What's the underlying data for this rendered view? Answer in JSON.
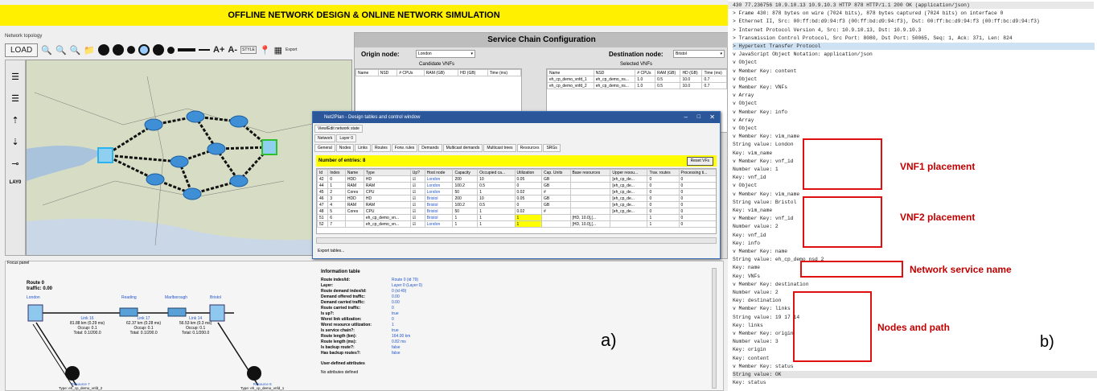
{
  "title": "OFFLINE NETWORK DESIGN & ONLINE NETWORK SIMULATION",
  "topology_label": "Network topology",
  "toolbar": {
    "load": "LOAD",
    "textplus": "A+",
    "textminus": "A-",
    "style": "STYLE",
    "export": "Export"
  },
  "sidebar_layer": "LAY0",
  "service_chain": {
    "header": "Service Chain Configuration",
    "origin_label": "Origin node:",
    "origin_value": "London",
    "destination_label": "Destination node:",
    "destination_value": "Bristol",
    "candidate_title": "Candidate VNFs",
    "selected_title": "Selected VNFs",
    "candidate_cols": [
      "Name",
      "NSD",
      "# CPUs",
      "RAM (GB)",
      "HD (GB)",
      "Time (ms)"
    ],
    "selected_cols": [
      "Name",
      "NSD",
      "# CPUs",
      "RAM (GB)",
      "HD (GB)",
      "Time (ms)"
    ],
    "selected_rows": [
      [
        "eh_cp_demo_vnfd_1",
        "eh_cp_demo_ns...",
        "1.0",
        "0.5",
        "10.0",
        "0.7"
      ],
      [
        "eh_cp_demo_vnfd_2",
        "eh_cp_demo_ns...",
        "1.0",
        "0.5",
        "10.0",
        "0.7"
      ]
    ]
  },
  "dialog": {
    "title": "Net2Plan - Design tables and control window",
    "view_tab": "View/Edit network state",
    "sub_tabs": [
      "Network",
      "Layer 0"
    ],
    "tabs": [
      "General",
      "Nodes",
      "Links",
      "Routes",
      "Forw. rules",
      "Demands",
      "Multicast demands",
      "Multicast trees",
      "Resources",
      "SRGs"
    ],
    "entries": "Number of entries: 8",
    "reset_button": "Reset VFs",
    "cols": [
      "Id",
      "Index",
      "Name",
      "Type",
      "Up?",
      "Host node",
      "Capacity",
      "Occupied ca...",
      "Utilization",
      "Cap. Units",
      "Base resources",
      "Upper resou...",
      "Trav. routes",
      "Processing ti..."
    ],
    "rows": [
      [
        "42",
        "0",
        "HDD",
        "HD",
        "☑",
        "London",
        "200",
        "10",
        "0.05",
        "GB",
        "",
        "[eh_cp_de...",
        "0",
        "0"
      ],
      [
        "44",
        "1",
        "RAM",
        "RAM",
        "☑",
        "London",
        "100.2",
        "0.5",
        "0",
        "GB",
        "",
        "[eh_cp_de...",
        "0",
        "0"
      ],
      [
        "45",
        "2",
        "Cores",
        "CPU",
        "☑",
        "London",
        "50",
        "1",
        "0.02",
        "#",
        "",
        "[eh_cp_de...",
        "0",
        "0"
      ],
      [
        "46",
        "3",
        "HDD",
        "HD",
        "☑",
        "Bristol",
        "200",
        "10",
        "0.05",
        "GB",
        "",
        "[eh_cp_de...",
        "0",
        "0"
      ],
      [
        "47",
        "4",
        "RAM",
        "RAM",
        "☑",
        "Bristol",
        "100.2",
        "0.5",
        "0",
        "GB",
        "",
        "[eh_cp_de...",
        "0",
        "0"
      ],
      [
        "48",
        "5",
        "Cores",
        "CPU",
        "☑",
        "Bristol",
        "50",
        "1",
        "0.02",
        "#",
        "",
        "[eh_cp_de...",
        "0",
        "0"
      ],
      [
        "51",
        "6",
        "",
        "eh_cp_demo_vn...",
        "☑",
        "Bristol",
        "1",
        "1",
        "1",
        "",
        "[HD, 10.0],[...",
        "",
        "1",
        "0"
      ],
      [
        "52",
        "7",
        "",
        "eh_cp_demo_vn...",
        "☑",
        "London",
        "1",
        "1",
        "1",
        "",
        "[HD, 10.0],[...",
        "",
        "1",
        "0"
      ]
    ],
    "export": "Export tables..."
  },
  "focus": {
    "label": "Focus panel",
    "route": "Route 0",
    "traffic": "traffic: 0.00",
    "nodes": [
      "London",
      "Reading",
      "Marlborough",
      "Bristol"
    ],
    "links": [
      {
        "name": "Link 16",
        "l1": "81.88 km (0.29 ms)",
        "l2": "Occup: 0.1",
        "l3": "Total: 0.1/200.0"
      },
      {
        "name": "Link 17",
        "l1": "62.37 km (0.28 ms)",
        "l2": "Occup: 0.1",
        "l3": "Total: 0.1/200.0"
      },
      {
        "name": "Link 14",
        "l1": "56.53 km (0.3 ms)",
        "l2": "Occup: 0.1",
        "l3": "Total: 0.1/200.0"
      }
    ],
    "resources": [
      {
        "name": "Resource 7",
        "type": "Type: eh_cp_demo_vnfd_2"
      },
      {
        "name": "Resource 6",
        "type": "Type: eh_cp_demo_vnfd_1"
      }
    ],
    "info_title": "Information table",
    "info_rows": [
      [
        "Route index/id:",
        "Route 0 (id 79)"
      ],
      [
        "Layer:",
        "Layer 0 (Layer 0)"
      ],
      [
        "Route demand index/id:",
        "0 (id 49)"
      ],
      [
        "Demand offered traffic:",
        "0.00"
      ],
      [
        "Demand carried traffic:",
        "0.00"
      ],
      [
        "Route carried traffic:",
        "0"
      ],
      [
        "Is up?:",
        "true"
      ],
      [
        "Worst link utilization:",
        "0"
      ],
      [
        "Worst resource utilization:",
        "1"
      ],
      [
        "Is service chain?:",
        "true"
      ],
      [
        "Route length (km):",
        "164.00 km"
      ],
      [
        "Route length (ms):",
        "0.82 ms"
      ],
      [
        "Is backup route?:",
        "false"
      ],
      [
        "Has backup routes?:",
        "false"
      ]
    ],
    "user_attrs": "User-defined attributes",
    "no_attrs": "No attributes defined",
    "label_a": "a)"
  },
  "json_tree": {
    "lines": [
      "430 77.236756     10.9.10.13          10.9.10.3         HTTP     878 HTTP/1.1 200 OK  (application/json)",
      "> Frame 430: 878 bytes on wire (7024 bits), 878 bytes captured (7024 bits) on interface 0",
      "> Ethernet II, Src: 00:ff:bd:d9:94:f3 (00:ff:bd:d9:94:f3), Dst: 00:ff:bc:d9:94:f3 (00:ff:bc:d9:94:f3)",
      "> Internet Protocol Version 4, Src: 10.9.10.13, Dst: 10.9.10.3",
      "> Transmission Control Protocol, Src Port: 8080, Dst Port: 50065, Seq: 1, Ack: 371, Len: 824",
      "> Hypertext Transfer Protocol",
      "v JavaScript Object Notation: application/json",
      "  v Object",
      "    v Member Key: content",
      "      v Object",
      "        v Member Key: VNFs",
      "          v Array",
      "            v Object",
      "              v Member Key: info",
      "                v Array",
      "                  v Object",
      "                    v Member Key: vim_name",
      "                        String value: London",
      "                        Key: vim_name",
      "                    v Member Key: vnf_id",
      "                        Number value: 1",
      "                        Key: vnf_id",
      "                  v Object",
      "                    v Member Key: vim_name",
      "                        String value: Bristol",
      "                        Key: vim_name",
      "                    v Member Key: vnf_id",
      "                        Number value: 2",
      "                        Key: vnf_id",
      "                  Key: info",
      "              v Member Key: name",
      "                  String value: eh_cp_demo_nsd_2",
      "                  Key: name",
      "            Key: VNFs",
      "        v Member Key: destination",
      "            Number value: 2",
      "            Key: destination",
      "        v Member Key: links",
      "            String value: 19 17 14",
      "            Key: links",
      "        v Member Key: origin",
      "            Number value: 3",
      "            Key: origin",
      "      Key: content",
      "  v Member Key: status",
      "      String value: OK",
      "      Key: status"
    ],
    "annotations": [
      "VNF1 placement",
      "VNF2 placement",
      "Network service name",
      "Nodes and path"
    ],
    "label_b": "b)"
  }
}
